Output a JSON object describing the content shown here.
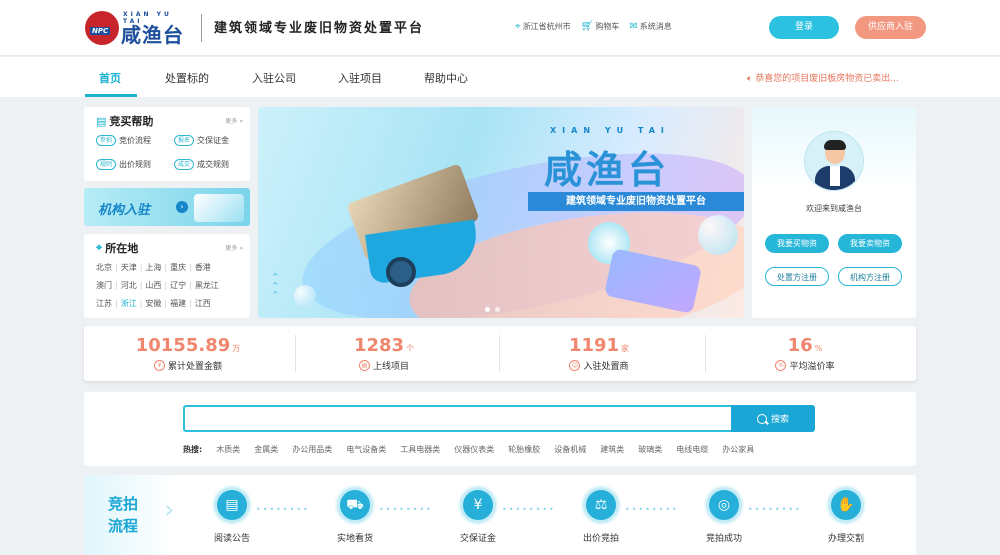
{
  "header": {
    "logo_en": "XIAN YU TAI",
    "logo_cn": "咸渔台",
    "logo_badge": "NPC",
    "slogan": "建筑领域专业废旧物资处置平台",
    "location": "浙江省杭州市",
    "cart": "购物车",
    "messages": "系统消息",
    "login": "登录",
    "supplier": "供应商入驻",
    "icons": {
      "location": "location-pin-icon",
      "cart": "cart-icon",
      "messages": "message-icon"
    }
  },
  "nav": {
    "items": [
      "首页",
      "处置标的",
      "入驻公司",
      "入驻项目",
      "帮助中心"
    ],
    "notice": "恭喜您的项目废旧板房物资已卖出..."
  },
  "help": {
    "title": "竞买帮助",
    "more": "更多 »",
    "items": [
      {
        "tag": "参拍",
        "label": "竞价流程"
      },
      {
        "tag": "报名",
        "label": "交保证金"
      },
      {
        "tag": "规则",
        "label": "出价规则"
      },
      {
        "tag": "成交",
        "label": "成交规则"
      }
    ]
  },
  "join_banner": {
    "text": "机构入驻"
  },
  "location_card": {
    "title": "所在地",
    "more": "更多 »",
    "rows": [
      [
        "北京",
        "天津",
        "上海",
        "重庆",
        "香港"
      ],
      [
        "澳门",
        "河北",
        "山西",
        "辽宁",
        "黑龙江"
      ],
      [
        "江苏",
        "浙江",
        "安徽",
        "福建",
        "江西"
      ]
    ],
    "active": "浙江"
  },
  "hero": {
    "en": "XIAN YU TAI",
    "cn": "咸渔台",
    "bar": "建筑领域专业废旧物资处置平台"
  },
  "user": {
    "welcome": "欢迎来到咸渔台",
    "buy": "我要买物资",
    "sell": "我要卖物资",
    "register_dispose": "处置方注册",
    "register_org": "机构方注册"
  },
  "stats": [
    {
      "value": "10155.89",
      "unit": "万",
      "label": "累计处置金额",
      "icon": "yuan-icon"
    },
    {
      "value": "1283",
      "unit": "个",
      "label": "上线项目",
      "icon": "document-icon"
    },
    {
      "value": "1191",
      "unit": "家",
      "label": "入驻处置商",
      "icon": "user-icon"
    },
    {
      "value": "16",
      "unit": "%",
      "label": "平均溢价率",
      "icon": "percent-icon"
    }
  ],
  "search": {
    "placeholder": "",
    "button": "搜索",
    "hot_label": "热搜:",
    "hot": [
      "木质类",
      "金属类",
      "办公用品类",
      "电气设备类",
      "工具电器类",
      "仪器仪表类",
      "轮胎橡胶",
      "设备机械",
      "建筑类",
      "玻璃类",
      "电线电缆",
      "办公家具"
    ]
  },
  "flow": {
    "title1": "竞拍",
    "title2": "流程",
    "steps": [
      {
        "label": "阅读公告",
        "icon": "notice-icon",
        "glyph": "▤"
      },
      {
        "label": "实地看货",
        "icon": "truck-icon",
        "glyph": "⛟"
      },
      {
        "label": "交保证金",
        "icon": "deposit-icon",
        "glyph": "¥"
      },
      {
        "label": "出价竞拍",
        "icon": "gavel-icon",
        "glyph": "⚖"
      },
      {
        "label": "竞拍成功",
        "icon": "target-icon",
        "glyph": "◎"
      },
      {
        "label": "办理交割",
        "icon": "handshake-icon",
        "glyph": "✋"
      }
    ]
  }
}
